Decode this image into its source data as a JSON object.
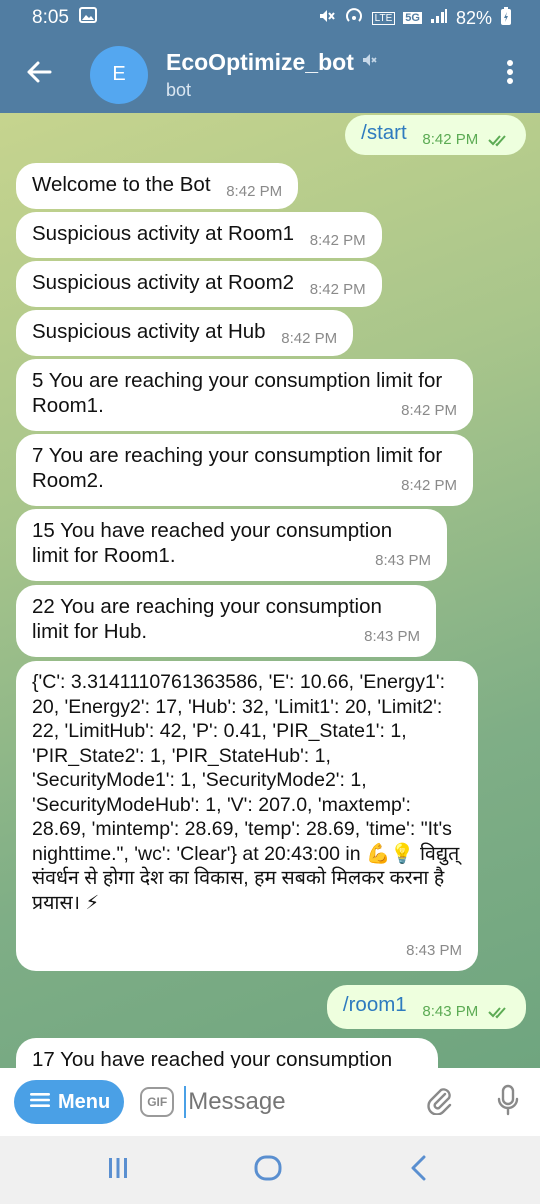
{
  "status_bar": {
    "time": "8:05",
    "network": "5G",
    "lte": "LTE",
    "battery": "82%"
  },
  "header": {
    "avatar_letter": "E",
    "title": "EcoOptimize_bot",
    "subtitle": "bot"
  },
  "messages": [
    {
      "text": "/start",
      "time": "8:42 PM"
    },
    {
      "text": "Welcome to the Bot",
      "time": "8:42 PM"
    },
    {
      "text": "Suspicious activity at Room1",
      "time": "8:42 PM"
    },
    {
      "text": "Suspicious activity at Room2",
      "time": "8:42 PM"
    },
    {
      "text": "Suspicious activity at Hub",
      "time": "8:42 PM"
    },
    {
      "text": "5 You are reaching your consumption limit for Room1.",
      "time": "8:42 PM"
    },
    {
      "text": "7 You are reaching your consumption limit for Room2.",
      "time": "8:42 PM"
    },
    {
      "text": "15 You have reached your consumption limit for Room1.",
      "time": "8:43 PM"
    },
    {
      "text": "22 You are reaching your consumption limit for Hub.",
      "time": "8:43 PM"
    },
    {
      "text": "{'C': 3.3141110761363586, 'E': 10.66, 'Energy1': 20, 'Energy2': 17, 'Hub': 32, 'Limit1': 20, 'Limit2': 22, 'LimitHub': 42, 'P': 0.41, 'PIR_State1': 1, 'PIR_State2': 1, 'PIR_StateHub': 1, 'SecurityMode1': 1, 'SecurityMode2': 1, 'SecurityModeHub': 1, 'V': 207.0, 'maxtemp': 28.69, 'mintemp': 28.69, 'temp': 28.69, 'time': \"It's nighttime.\", 'wc': 'Clear'} at 20:43:00 in 💪💡 विद्युत् संवर्धन से होगा देश का विकास, हम सबको मिलकर करना है प्रयास। ⚡",
      "time": "8:43 PM"
    },
    {
      "text": "/room1",
      "time": "8:43 PM"
    },
    {
      "text": "17 You have reached your consumption",
      "time": ""
    }
  ],
  "input": {
    "menu_label": "Menu",
    "gif_label": "GIF",
    "placeholder": "Message"
  },
  "icons": {
    "back": "arrow-left-icon",
    "more": "vertical-dots-icon",
    "muted": "speaker-muted-icon",
    "read": "double-check-icon",
    "attach": "paperclip-icon",
    "mic": "microphone-icon",
    "nav_recents": "recents-icon",
    "nav_home": "home-icon",
    "nav_back": "back-chevron-icon"
  },
  "colors": {
    "header": "#517da2",
    "incoming_bubble": "#ffffff",
    "outgoing_bubble": "#eeffde",
    "accent": "#4aa0e6"
  }
}
